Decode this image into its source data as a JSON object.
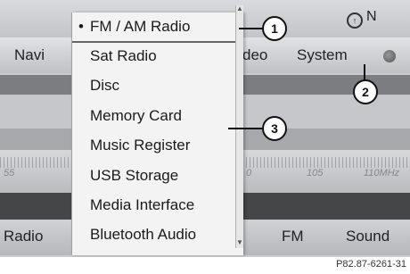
{
  "header": {
    "compass_direction": "N"
  },
  "menubar": {
    "navi": "Navi",
    "video_partial": "deo",
    "system": "System"
  },
  "radio_display": {
    "freq_left": "55",
    "freq_mid": "0",
    "freq_105": "105",
    "freq_right": "110MHz"
  },
  "bottombar": {
    "radio": "Radio",
    "fm": "FM",
    "sound": "Sound"
  },
  "dropdown": {
    "items": [
      {
        "label": "FM / AM Radio",
        "selected": true
      },
      {
        "label": "Sat Radio"
      },
      {
        "label": "Disc"
      },
      {
        "label": "Memory Card"
      },
      {
        "label": "Music Register"
      },
      {
        "label": "USB Storage"
      },
      {
        "label": "Media Interface"
      },
      {
        "label": "Bluetooth Audio"
      }
    ]
  },
  "callouts": [
    "1",
    "2",
    "3"
  ],
  "caption": "P82.87-6261-31"
}
